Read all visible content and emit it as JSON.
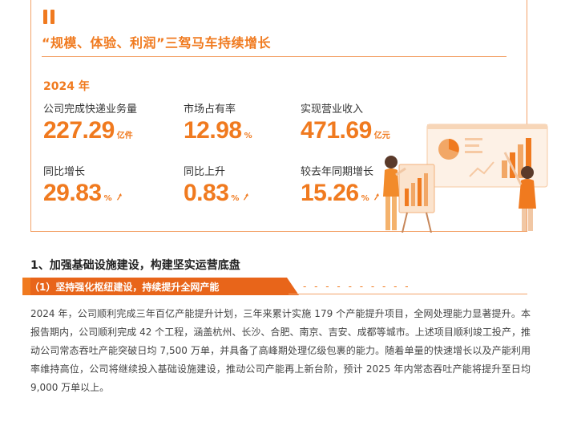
{
  "card": {
    "title": "“规模、体验、利润”三驾马车持续增长",
    "year": "2024 年",
    "stats": [
      {
        "label": "公司完成快递业务量",
        "value": "227.29",
        "unit": "亿件",
        "arrow": false
      },
      {
        "label": "市场占有率",
        "value": "12.98",
        "unit": "%",
        "arrow": false
      },
      {
        "label": "实现营业收入",
        "value": "471.69",
        "unit": "亿元",
        "arrow": false
      },
      {
        "label": "同比增长",
        "value": "29.83",
        "unit": "%",
        "arrow": true
      },
      {
        "label": "同比上升",
        "value": "0.83",
        "unit": "%",
        "arrow": true
      },
      {
        "label": "较去年同期增长",
        "value": "15.26",
        "unit": "%",
        "arrow": true
      }
    ]
  },
  "section": {
    "title": "1、加强基础设施建设，构建坚实运营底盘",
    "subtitle": "（1）坚持强化枢纽建设，持续提升全网产能",
    "paragraph": "2024 年，公司顺利完成三年百亿产能提升计划，三年来累计实施 179 个产能提升项目，全网处理能力显著提升。本报告期内，公司顺利完成 42 个工程，涵盖杭州、长沙、合肥、南京、吉安、成都等城市。上述项目顺利竣工投产，推动公司常态吞吐产能突破日均 7,500 万单，并具备了高峰期处理亿级包裹的能力。随着单量的快速增长以及产能利用率维持高位，公司将继续投入基础设施建设，推动公司产能再上新台阶，预计 2025 年内常态吞吐产能将提升至日均 9,000 万单以上。"
  },
  "colors": {
    "accent": "#f07a1f",
    "border": "#f3a36a",
    "banner_dark": "#e8651a"
  }
}
